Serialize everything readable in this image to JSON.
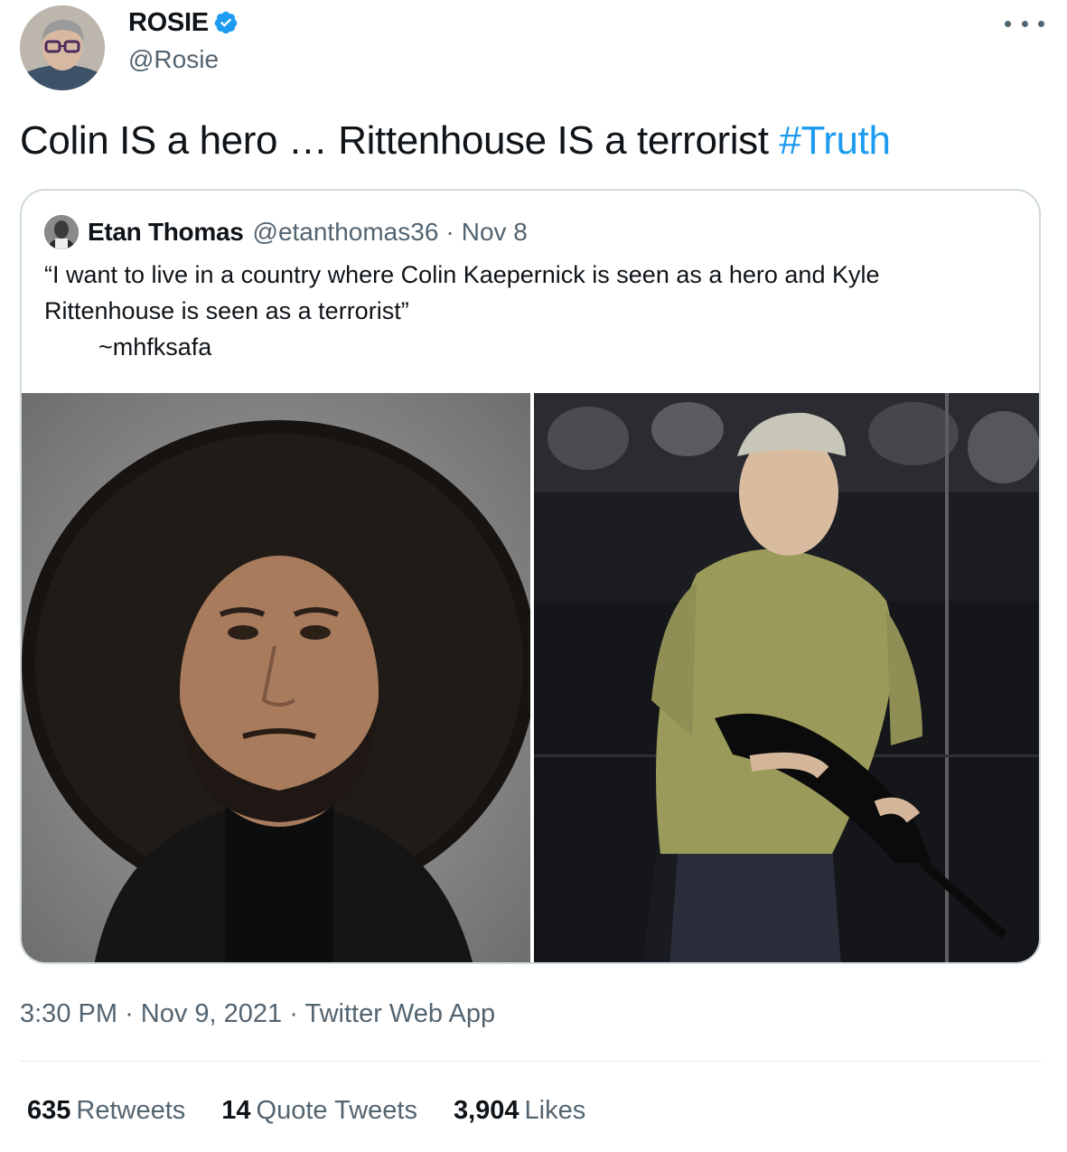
{
  "author": {
    "name": "ROSIE",
    "handle": "@Rosie",
    "verified": true,
    "avatar_icon": "user-avatar"
  },
  "tweet": {
    "text": "Colin IS a hero … Rittenhouse IS a terrorist",
    "hashtag": "#Truth"
  },
  "quoted": {
    "name": "Etan Thomas",
    "handle": "@etanthomas36",
    "separator": "·",
    "date": "Nov 8",
    "line1": "“I want to live in a country where Colin Kaepernick is seen as a hero and Kyle",
    "line2": "Rittenhouse is seen as a terrorist”",
    "signature": "~mhfksafa"
  },
  "meta": {
    "time": "3:30 PM",
    "sep": "·",
    "date": "Nov 9, 2021",
    "app": "Twitter Web App"
  },
  "stats": {
    "retweets_count": "635",
    "retweets_label": "Retweets",
    "quotes_count": "14",
    "quotes_label": "Quote Tweets",
    "likes_count": "3,904",
    "likes_label": "Likes"
  },
  "colors": {
    "accent": "#1d9bf0",
    "muted": "#536471",
    "border": "#cfd9de"
  }
}
